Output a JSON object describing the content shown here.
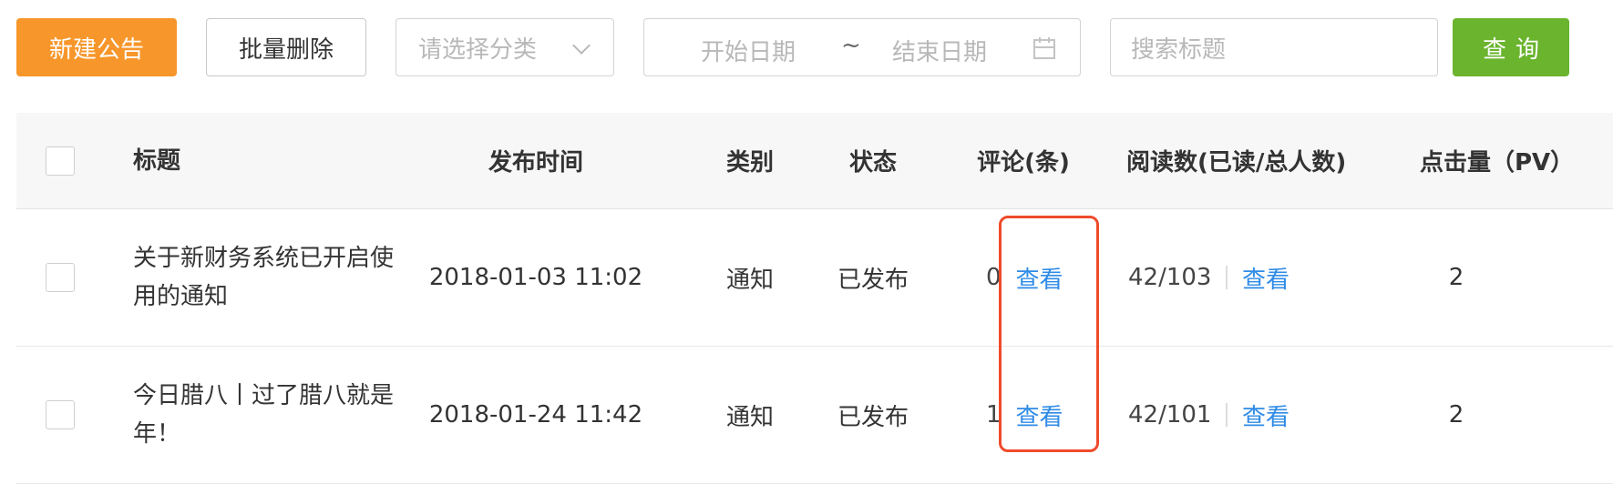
{
  "toolbar": {
    "new_button": "新建公告",
    "batch_delete_button": "批量删除",
    "category_placeholder": "请选择分类",
    "start_date_placeholder": "开始日期",
    "date_separator": "~",
    "end_date_placeholder": "结束日期",
    "search_placeholder": "搜索标题",
    "query_button": "查询"
  },
  "table": {
    "headers": {
      "title": "标题",
      "publish_time": "发布时间",
      "category": "类别",
      "status": "状态",
      "comments": "评论(条)",
      "reads": "阅读数(已读/总人数)",
      "pv": "点击量（PV）"
    },
    "rows": [
      {
        "title": "关于新财务系统已开启使用的通知",
        "publish_time": "2018-01-03 11:02",
        "category": "通知",
        "status": "已发布",
        "comment_count": "0",
        "comment_link": "查看",
        "reads": "42/103",
        "reads_link": "查看",
        "pv": "2"
      },
      {
        "title": "今日腊八丨过了腊八就是年！",
        "publish_time": "2018-01-24 11:42",
        "category": "通知",
        "status": "已发布",
        "comment_count": "1",
        "comment_link": "查看",
        "reads": "42/101",
        "reads_link": "查看",
        "pv": "2"
      }
    ]
  },
  "colors": {
    "primary_orange": "#f7962a",
    "query_green": "#6ab42e",
    "link_blue": "#2f8be6",
    "highlight_red": "#ef4b2b"
  },
  "icons": [
    "chevron-down-icon",
    "calendar-icon",
    "checkbox"
  ]
}
